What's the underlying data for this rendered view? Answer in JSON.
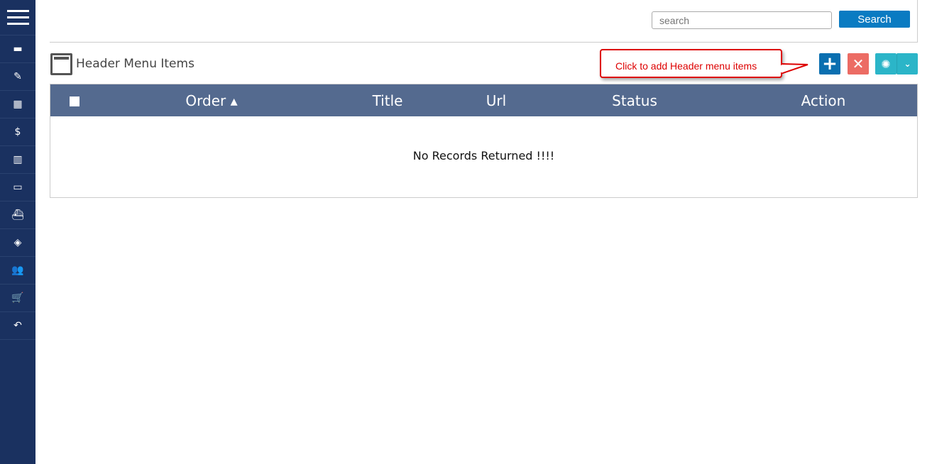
{
  "sidebar": {
    "items": [
      {
        "icon": "id-card-icon",
        "glyph": "▬"
      },
      {
        "icon": "notes-edit-icon",
        "glyph": "✎"
      },
      {
        "icon": "layout-icon",
        "glyph": "▦"
      },
      {
        "icon": "money-bag-icon",
        "glyph": "$"
      },
      {
        "icon": "book-icon",
        "glyph": "▥"
      },
      {
        "icon": "ticket-icon",
        "glyph": "▭"
      },
      {
        "icon": "ship-icon",
        "glyph": "⛴"
      },
      {
        "icon": "box-icon",
        "glyph": "◈"
      },
      {
        "icon": "users-icon",
        "glyph": "👥"
      },
      {
        "icon": "cart-icon",
        "glyph": "🛒"
      },
      {
        "icon": "undo-icon",
        "glyph": "↶"
      }
    ]
  },
  "topbar": {
    "search_placeholder": "search",
    "search_label": "Search"
  },
  "page": {
    "title": "Header Menu Items",
    "callout": "Click to add Header menu items"
  },
  "actions": {
    "add": "+",
    "delete": "✕",
    "gear": "✺",
    "dropdown": "⌄"
  },
  "table": {
    "columns": [
      "Order ▴",
      "Title",
      "Url",
      "Status",
      "Action"
    ],
    "empty": "No Records Returned !!!!"
  },
  "colors": {
    "sidebar": "#1a3160",
    "primary": "#0a7bc2",
    "danger": "#ec6c64",
    "info": "#2bb5c8",
    "table_header": "#546a8f",
    "callout": "#dd0000"
  }
}
